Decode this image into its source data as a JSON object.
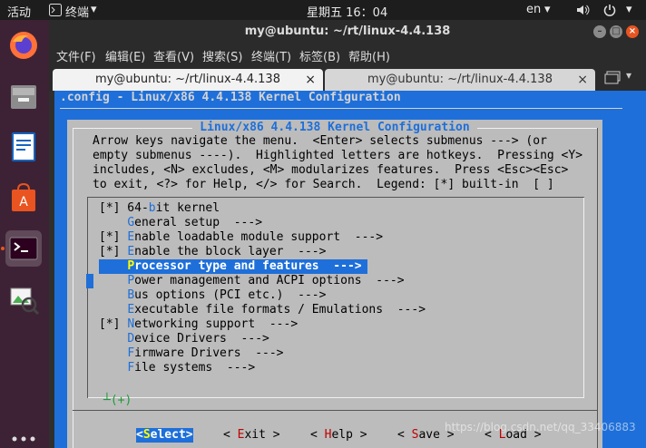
{
  "topbar": {
    "activities": "活动",
    "app_name": "终端",
    "app_arrow": "▾",
    "clock": "星期五 16：04",
    "lang": "en",
    "lang_arrow": "▾",
    "volume_icon": "speaker-icon",
    "power_icon": "power-icon"
  },
  "dock": {
    "items": [
      "firefox-icon",
      "files-icon",
      "writer-icon",
      "software-center-icon",
      "terminal-icon",
      "image-viewer-icon"
    ],
    "apps_icon": "show-applications-icon"
  },
  "window": {
    "title": "my@ubuntu: ~/rt/linux-4.4.138",
    "menu": [
      "文件(F)",
      "编辑(E)",
      "查看(V)",
      "搜索(S)",
      "终端(T)",
      "标签(B)",
      "帮助(H)"
    ],
    "tabs": [
      {
        "label": "my@ubuntu: ~/rt/linux-4.4.138",
        "close": "×"
      },
      {
        "label": "my@ubuntu: ~/rt/linux-4.4.138",
        "close": "×"
      }
    ],
    "new_tab_icon": "new-tab-icon"
  },
  "terminal": {
    "config_title": ".config - Linux/x86 4.4.138 Kernel Configuration",
    "dialog_title": " Linux/x86 4.4.138 Kernel Configuration ",
    "help_lines": [
      "Arrow keys navigate the menu.  <Enter> selects submenus ---> (or",
      "empty submenus ----).  Highlighted letters are hotkeys.  Pressing <Y>",
      "includes, <N> excludes, <M> modularizes features.  Press <Esc><Esc>",
      "to exit, <?> for Help, </> for Search.  Legend: [*] built-in  [ ]"
    ],
    "menu_items": [
      {
        "pre": "[*] 64-",
        "hot": "b",
        "post": "it kernel"
      },
      {
        "pre": "    ",
        "hot": "G",
        "post": "eneral setup  --->"
      },
      {
        "pre": "[*] ",
        "hot": "E",
        "post": "nable loadable module support  --->"
      },
      {
        "pre": "[*] ",
        "hot": "E",
        "post": "nable the block layer  --->"
      },
      {
        "pre": "    ",
        "hot": "P",
        "post": "rocessor type and features  --->"
      },
      {
        "pre": "    ",
        "hot": "P",
        "post": "ower management and ACPI options  --->"
      },
      {
        "pre": "    ",
        "hot": "B",
        "post": "us options (PCI etc.)  --->"
      },
      {
        "pre": "    ",
        "hot": "E",
        "post": "xecutable file formats / Emulations  --->"
      },
      {
        "pre": "[*] ",
        "hot": "N",
        "post": "etworking support  --->"
      },
      {
        "pre": "    ",
        "hot": "D",
        "post": "evice Drivers  --->"
      },
      {
        "pre": "    ",
        "hot": "F",
        "post": "irmware Drivers  --->"
      },
      {
        "pre": "    ",
        "hot": "F",
        "post": "ile systems  --->"
      }
    ],
    "selected_index": 4,
    "more_indicator": "┴(+)",
    "buttons": [
      {
        "pre": "<",
        "hot": "S",
        "post": "elect>"
      },
      {
        "pre": "< ",
        "hot": "E",
        "post": "xit >"
      },
      {
        "pre": "< ",
        "hot": "H",
        "post": "elp >"
      },
      {
        "pre": "< ",
        "hot": "S",
        "post": "ave >"
      },
      {
        "pre": "< ",
        "hot": "L",
        "post": "oad >"
      }
    ],
    "selected_button": 0
  },
  "watermark": "https://blog.csdn.net/qq_33406883"
}
